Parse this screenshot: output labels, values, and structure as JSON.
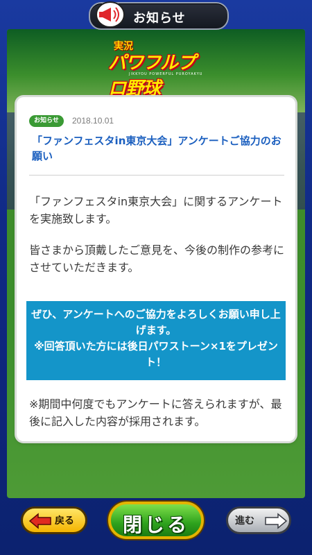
{
  "header": {
    "title": "お知らせ"
  },
  "logo": {
    "top": "実況",
    "main": "パワフルプロ野球",
    "sub": "JIKKYOU POWERFUL PUROYAKYU"
  },
  "notice": {
    "badge": "お知らせ",
    "date": "2018.10.01",
    "headline": "「ファンフェスタin東京大会」アンケートご協力のお願い",
    "paragraph1": "「ファンフェスタin東京大会」に関するアンケートを実施致します。",
    "paragraph2": "皆さまから頂戴したご意見を、今後の制作の参考にさせていただきます。",
    "highlight_line1": "ぜひ、アンケートへのご協力をよろしくお願い申し上げます。",
    "highlight_line2": "※回答頂いた方には後日パワストーン×1をプレゼント！",
    "paragraph3": "※期間中何度でもアンケートに答えられますが、最後に記入した内容が採用されます。"
  },
  "buttons": {
    "back_label": "戻る",
    "close_label": "閉じる",
    "next_label": "進む"
  },
  "colors": {
    "headline": "#1b5fbf",
    "highlight_bg": "#1495c9",
    "badge_bg": "#3a9a34"
  },
  "icons": {
    "header": "megaphone-icon",
    "back": "arrow-left-icon",
    "next": "arrow-right-icon"
  }
}
